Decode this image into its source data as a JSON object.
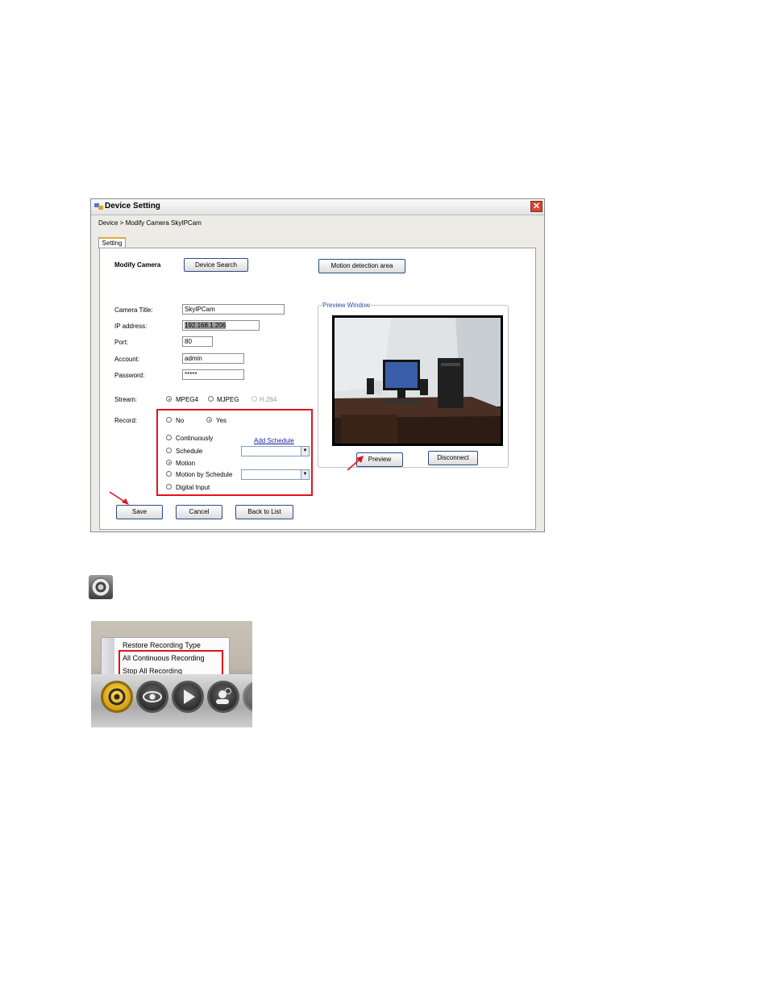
{
  "window": {
    "title": "Device Setting",
    "close_label": "✕",
    "breadcrumb": "Device > Modify Camera SkyIPCam",
    "tab_label": "Setting"
  },
  "form": {
    "heading": "Modify Camera",
    "device_search_label": "Device Search",
    "motion_area_label": "Motion detection area",
    "camera_title_label": "Camera Title:",
    "camera_title_value": "SkyIPCam",
    "ip_label": "IP address:",
    "ip_value": "192.168.1.206",
    "port_label": "Port:",
    "port_value": "80",
    "account_label": "Account:",
    "account_value": "admin",
    "password_label": "Password:",
    "password_value": "*****",
    "stream_label": "Stream:",
    "stream_options": [
      "MPEG4",
      "MJPEG",
      "H.264"
    ],
    "record_label": "Record:",
    "record_no": "No",
    "record_yes": "Yes",
    "record_modes": [
      "Continuously",
      "Schedule",
      "Motion",
      "Motion by Schedule",
      "Digital Input"
    ],
    "add_schedule_label": "Add Schedule",
    "save_label": "Save",
    "cancel_label": "Cancel",
    "back_label": "Back to List"
  },
  "preview": {
    "group_label": "Preview Window",
    "preview_label": "Preview",
    "disconnect_label": "Disconnect"
  },
  "menu": {
    "items": [
      "Restore Recording Type",
      "All Continuous Recording",
      "Stop All Recording"
    ]
  },
  "colors": {
    "highlight": "#e0141e",
    "link": "#1a1aa8",
    "button_border": "#2b4a88"
  }
}
